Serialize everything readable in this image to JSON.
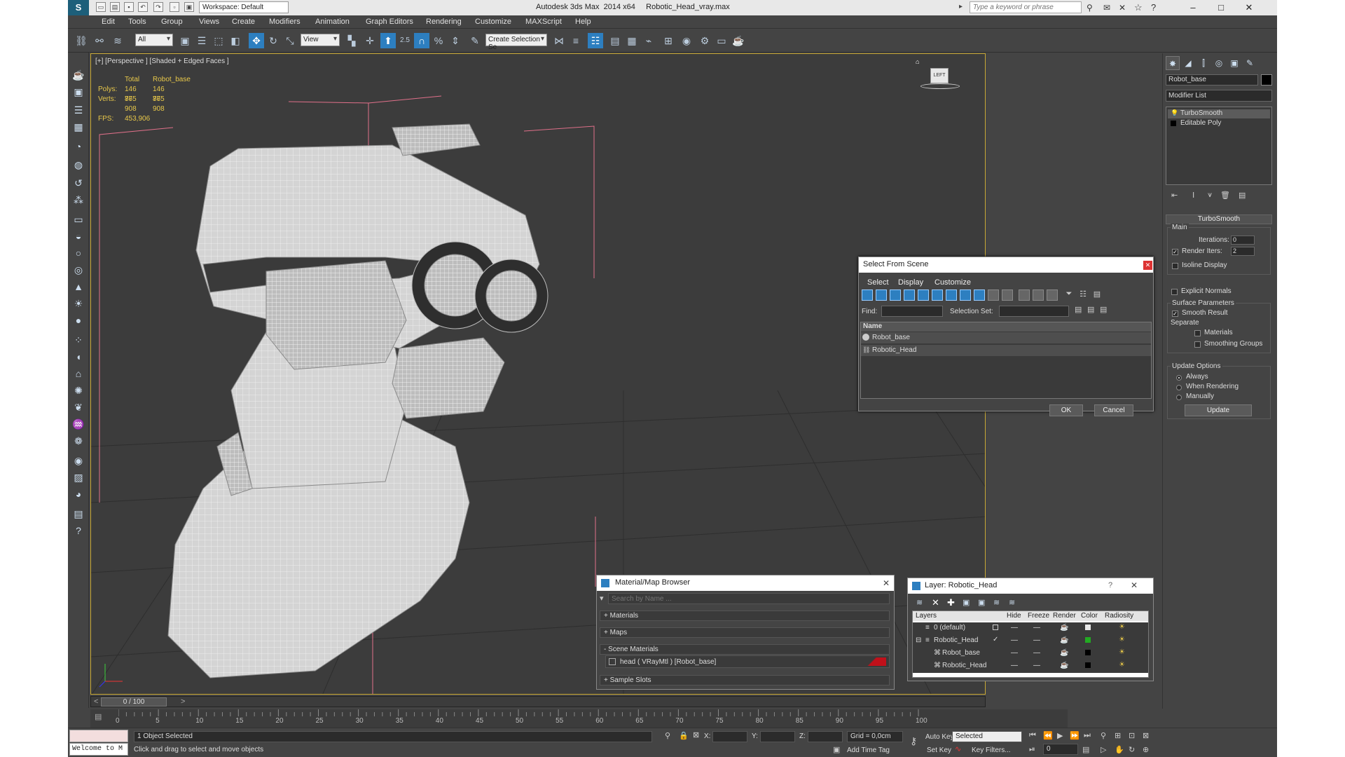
{
  "app": {
    "title": "Autodesk 3ds Max  2014 x64     Robotic_Head_vray.max",
    "workspace": "Workspace: Default",
    "search_placeholder": "Type a keyword or phrase"
  },
  "menu": [
    "Edit",
    "Tools",
    "Group",
    "Views",
    "Create",
    "Modifiers",
    "Animation",
    "Graph Editors",
    "Rendering",
    "Customize",
    "MAXScript",
    "Help"
  ],
  "toolbar": {
    "selection_filter": "All",
    "ref_coord": "View",
    "snap_value": "2.5",
    "selection_set": "Create Selection Se"
  },
  "viewport": {
    "label": "[+] [Perspective ] [Shaded + Edged Faces ]",
    "stats": {
      "col_total": "Total",
      "col_obj": "Robot_base",
      "polys_label": "Polys:",
      "polys_total": "146 865",
      "polys_obj": "146 865",
      "verts_label": "Verts:",
      "verts_total": "77 908",
      "verts_obj": "77 908",
      "fps_label": "FPS:",
      "fps_value": "453,906"
    },
    "viewcube": "LEFT"
  },
  "command_panel": {
    "object_name": "Robot_base",
    "object_color": "#000000",
    "modifier_list": "Modifier List",
    "stack": [
      "TurboSmooth",
      "Editable Poly"
    ],
    "rollout_title": "TurboSmooth",
    "main_label": "Main",
    "iterations_label": "Iterations:",
    "iterations_value": "0",
    "render_iters_label": "Render Iters:",
    "render_iters_value": "2",
    "isoline": "Isoline Display",
    "explicit": "Explicit Normals",
    "surface_params": "Surface Parameters",
    "smooth_result": "Smooth Result",
    "separate": "Separate",
    "materials": "Materials",
    "smoothing_groups": "Smoothing Groups",
    "update_options": "Update Options",
    "always": "Always",
    "when_rendering": "When Rendering",
    "manually": "Manually",
    "update_btn": "Update"
  },
  "select_dialog": {
    "title": "Select From Scene",
    "menus": [
      "Select",
      "Display",
      "Customize"
    ],
    "find_label": "Find:",
    "selset_label": "Selection Set:",
    "col_name": "Name",
    "items": [
      "Robot_base",
      "Robotic_Head"
    ],
    "ok": "OK",
    "cancel": "Cancel"
  },
  "material_browser": {
    "title": "Material/Map Browser",
    "search": "Search by Name ...",
    "materials": "+ Materials",
    "maps": "+ Maps",
    "scene_materials": "- Scene Materials",
    "scene_item": "head  ( VRayMtl ) [Robot_base]",
    "sample_slots": "+ Sample Slots"
  },
  "layer_dialog": {
    "title": "Layer: Robotic_Head",
    "cols": [
      "Layers",
      "Hide",
      "Freeze",
      "Render",
      "Color",
      "Radiosity"
    ],
    "rows": [
      {
        "name": "0 (default)",
        "color": "#e8e8e8"
      },
      {
        "name": "Robotic_Head",
        "color": "#22aa22"
      },
      {
        "name": "Robot_base",
        "color": "#000000"
      },
      {
        "name": "Robotic_Head",
        "color": "#000000"
      }
    ]
  },
  "timeline": {
    "frame": "0 / 100",
    "ticks": [
      "0",
      "5",
      "10",
      "15",
      "20",
      "25",
      "30",
      "35",
      "40",
      "45",
      "50",
      "55",
      "60",
      "65",
      "70",
      "75",
      "80",
      "85",
      "90",
      "95",
      "100"
    ]
  },
  "status": {
    "maxscript": "Welcome to M",
    "selected": "1 Object Selected",
    "prompt": "Click and drag to select and move objects",
    "x_label": "X:",
    "y_label": "Y:",
    "z_label": "Z:",
    "grid": "Grid = 0,0cm",
    "add_time_tag": "Add Time Tag",
    "auto_key": "Auto Key",
    "set_key": "Set Key",
    "key_mode": "Selected",
    "key_filters": "Key Filters...",
    "frame_value": "0"
  }
}
